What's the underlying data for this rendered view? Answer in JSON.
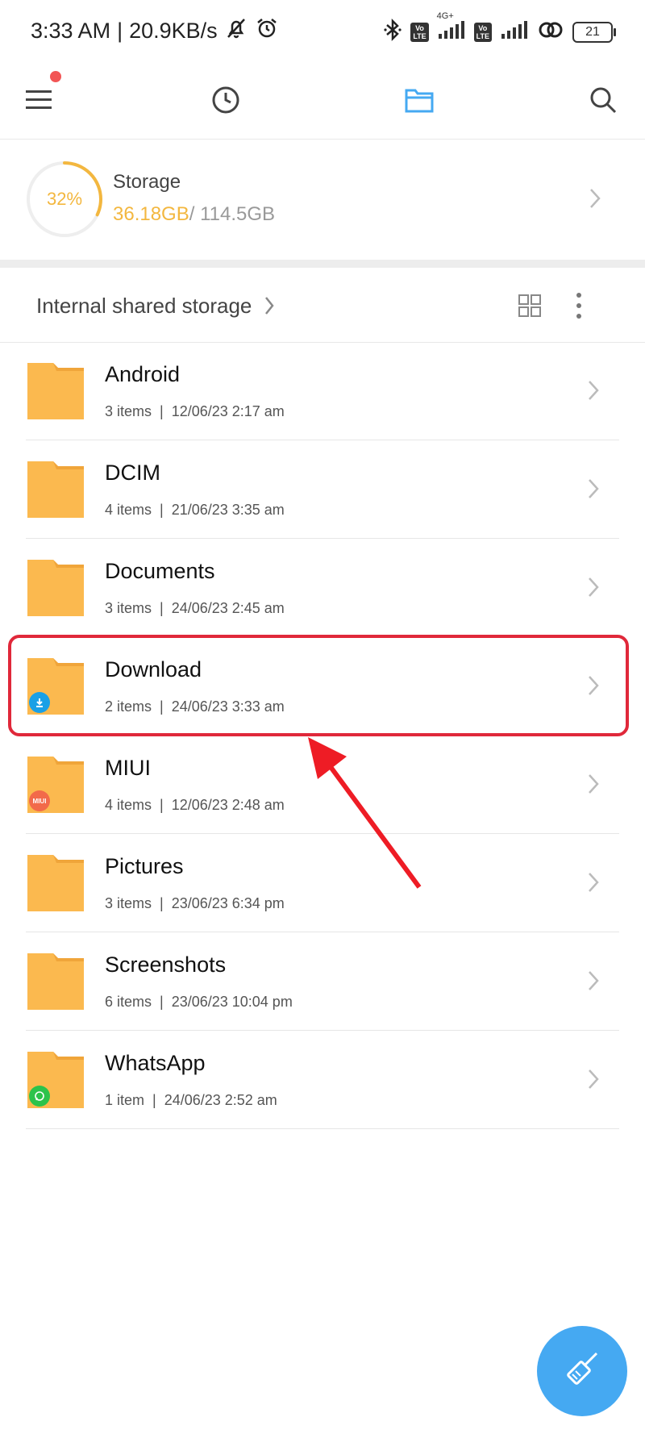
{
  "status_bar": {
    "time": "3:33 AM",
    "separator": "|",
    "speed": "20.9KB/s",
    "network": "4G+",
    "volte_label": "Vo\nLTE",
    "battery": "21"
  },
  "toolbar": {
    "icons": [
      "menu-icon",
      "recent-clock-icon",
      "folder-icon",
      "search-icon"
    ],
    "active": "folder-icon",
    "accent": "#45a9f2"
  },
  "storage": {
    "percent_label": "32%",
    "percent": 32,
    "title": "Storage",
    "used": "36.18GB",
    "total": "/ 114.5GB",
    "accent": "#f3b73f"
  },
  "path": {
    "label": "Internal shared storage"
  },
  "folders": [
    {
      "name": "Android",
      "meta": "3 items  |  12/06/23 2:17 am",
      "badge": null
    },
    {
      "name": "DCIM",
      "meta": "4 items  |  21/06/23 3:35 am",
      "badge": null
    },
    {
      "name": "Documents",
      "meta": "3 items  |  24/06/23 2:45 am",
      "badge": null
    },
    {
      "name": "Download",
      "meta": "2 items  |  24/06/23 3:33 am",
      "badge": "download"
    },
    {
      "name": "MIUI",
      "meta": "4 items  |  12/06/23 2:48 am",
      "badge": "miui",
      "badge_text": "MIUI"
    },
    {
      "name": "Pictures",
      "meta": "3 items  |  23/06/23 6:34 pm",
      "badge": null
    },
    {
      "name": "Screenshots",
      "meta": "6 items  |  23/06/23 10:04 pm",
      "badge": null
    },
    {
      "name": "WhatsApp",
      "meta": "1 item  |  24/06/23 2:52 am",
      "badge": "whatsapp"
    }
  ],
  "colors": {
    "folder": "#fbb94f",
    "folder_tab": "#f0a53a",
    "highlight": "#e0283a",
    "fab": "#45a9f2"
  }
}
